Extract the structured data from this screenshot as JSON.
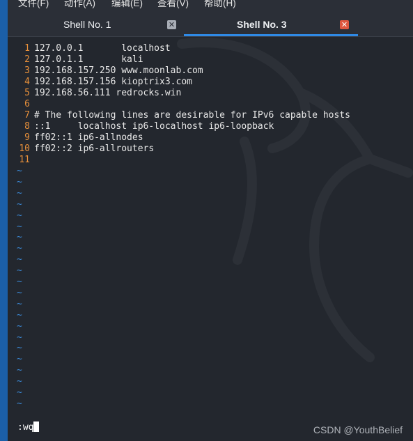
{
  "menubar": {
    "items": [
      "文件(F)",
      "动作(A)",
      "编辑(E)",
      "查看(V)",
      "帮助(H)"
    ]
  },
  "tabs": [
    {
      "label": "Shell No. 1",
      "active": false
    },
    {
      "label": "Shell No. 3",
      "active": true
    }
  ],
  "editor": {
    "lines": [
      {
        "num": "1",
        "text": "127.0.0.1       localhost"
      },
      {
        "num": "2",
        "text": "127.0.1.1       kali"
      },
      {
        "num": "3",
        "text": "192.168.157.250 www.moonlab.com"
      },
      {
        "num": "4",
        "text": "192.168.157.156 kioptrix3.com"
      },
      {
        "num": "5",
        "text": "192.168.56.111 redrocks.win"
      },
      {
        "num": "6",
        "text": ""
      },
      {
        "num": "7",
        "text": "# The following lines are desirable for IPv6 capable hosts"
      },
      {
        "num": "8",
        "text": "::1     localhost ip6-localhost ip6-loopback"
      },
      {
        "num": "9",
        "text": "ff02::1 ip6-allnodes"
      },
      {
        "num": "10",
        "text": "ff02::2 ip6-allrouters"
      },
      {
        "num": "11",
        "text": ""
      }
    ],
    "empty_marker": "~",
    "empty_line_count": 22,
    "command": ":wq"
  },
  "watermark": "CSDN @YouthBelief",
  "colors": {
    "background": "#23272e",
    "line_number": "#e8903a",
    "tilde": "#3b8ad8",
    "active_tab_underline": "#2f8ae6",
    "close_active": "#e0573f"
  },
  "icons": {
    "tab_close": "close-icon",
    "background_logo": "kali-dragon-icon"
  }
}
